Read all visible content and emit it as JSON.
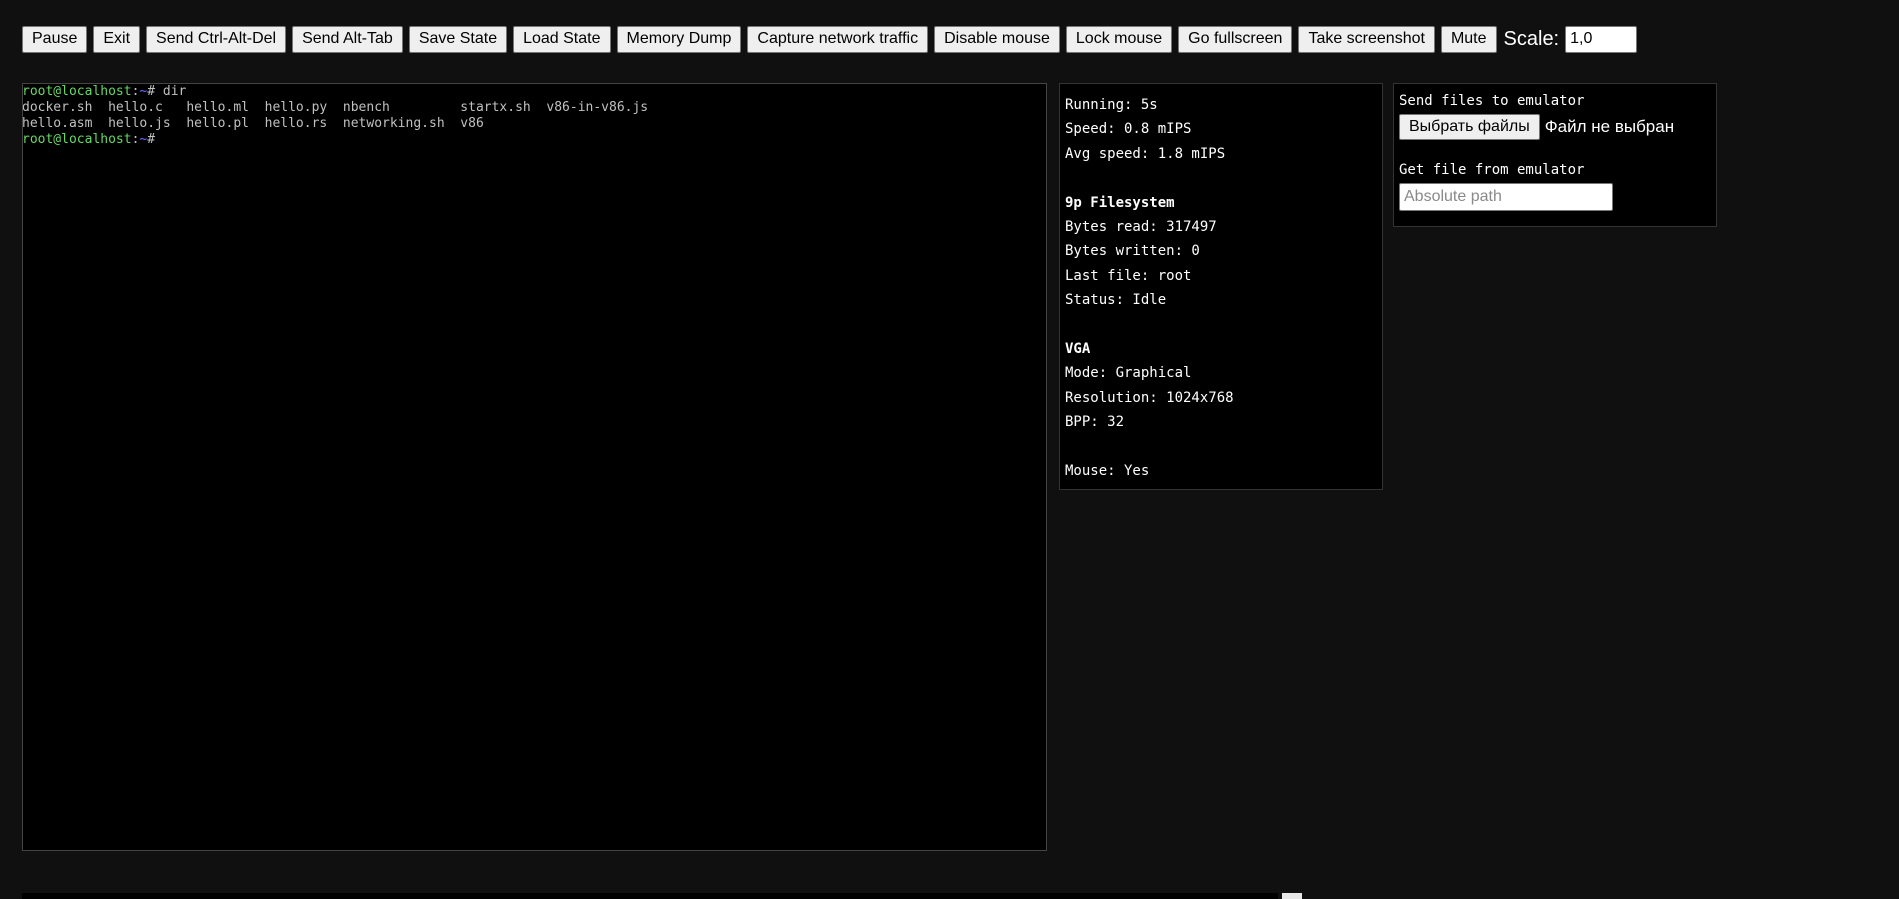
{
  "toolbar": {
    "buttons": [
      "Pause",
      "Exit",
      "Send Ctrl-Alt-Del",
      "Send Alt-Tab",
      "Save State",
      "Load State",
      "Memory Dump",
      "Capture network traffic",
      "Disable mouse",
      "Lock mouse",
      "Go fullscreen",
      "Take screenshot",
      "Mute"
    ],
    "scale_label": "Scale:",
    "scale_value": "1,0"
  },
  "terminal": {
    "line1": {
      "user": "root@localhost",
      "sep": ":",
      "tilde": "~",
      "cmd": "# dir"
    },
    "line2": "docker.sh  hello.c   hello.ml  hello.py  nbench         startx.sh  v86-in-v86.js",
    "line3": "hello.asm  hello.js  hello.pl  hello.rs  networking.sh  v86",
    "line4": {
      "user": "root@localhost",
      "sep": ":",
      "tilde": "~",
      "cmd": "#"
    }
  },
  "stats": {
    "running": "Running: 5s",
    "speed": "Speed: 0.8 mIPS",
    "avg_speed": "Avg speed: 1.8 mIPS",
    "fs_heading": "9p Filesystem",
    "bytes_read": "Bytes read: 317497",
    "bytes_written": "Bytes written: 0",
    "last_file": "Last file: root",
    "status": "Status: Idle",
    "vga_heading": "VGA",
    "mode": "Mode: Graphical",
    "resolution": "Resolution: 1024x768",
    "bpp": "BPP: 32",
    "mouse": "Mouse: Yes"
  },
  "files": {
    "send_heading": "Send files to emulator",
    "choose_button": "Выбрать файлы",
    "no_file": "Файл не выбран",
    "get_heading": "Get file from emulator",
    "path_placeholder": "Absolute path"
  }
}
